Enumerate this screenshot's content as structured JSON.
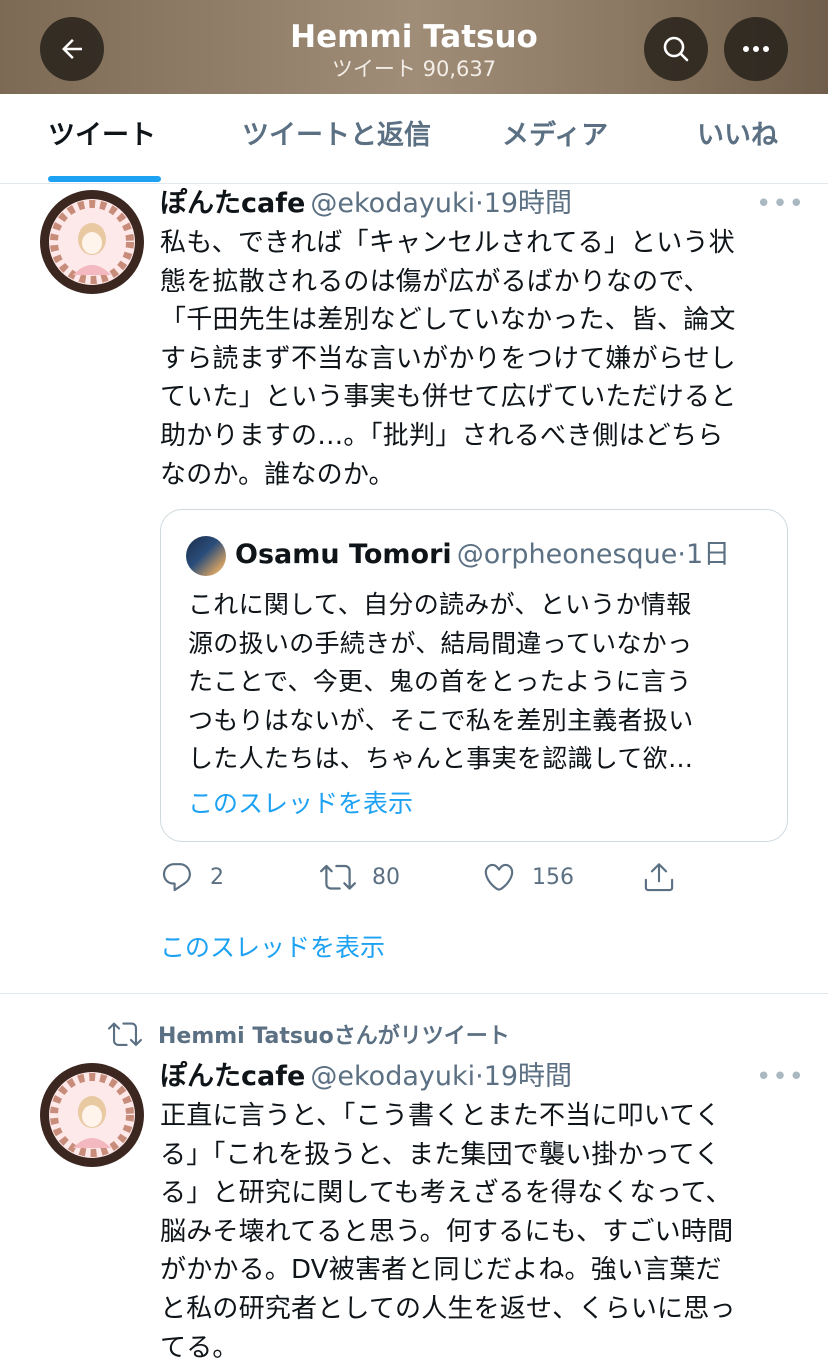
{
  "header": {
    "title": "Hemmi Tatsuo",
    "subtitle": "ツイート 90,637"
  },
  "tabs": [
    {
      "label": "ツイート",
      "active": true
    },
    {
      "label": "ツイートと返信",
      "active": false
    },
    {
      "label": "メディア",
      "active": false
    },
    {
      "label": "いいね",
      "active": false
    }
  ],
  "tweet1": {
    "name": "ぽんたcafe",
    "handle": "@ekodayuki",
    "time": "19時間",
    "more": "•••",
    "lines": [
      "私も、できれば「キャンセルされてる」という状",
      "態を拡散されるのは傷が広がるばかりなので、",
      "「千田先生は差別などしていなかった、皆、論文",
      "すら読まず不当な言いがかりをつけて嫌がらせし",
      "ていた」という事実も併せて広げていただけると",
      "助かりますの…。「批判」されるべき側はどちら",
      "なのか。誰なのか。"
    ],
    "quote": {
      "name": "Osamu Tomori",
      "handle": "@orpheonesque",
      "time": "1日",
      "lines": [
        "これに関して、自分の読みが、というか情報",
        "源の扱いの手続きが、結局間違っていなかっ",
        "たことで、今更、鬼の首をとったように言う",
        "つもりはないが、そこで私を差別主義者扱い",
        "した人たちは、ちゃんと事実を認識して欲…"
      ],
      "thread_link": "このスレッドを表示"
    },
    "actions": {
      "reply_count": "2",
      "retweet_count": "80",
      "like_count": "156"
    },
    "thread_link": "このスレッドを表示"
  },
  "tweet2": {
    "retweeted_by": "Hemmi Tatsuoさんがリツイート",
    "name": "ぽんたcafe",
    "handle": "@ekodayuki",
    "time": "19時間",
    "more": "•••",
    "lines": [
      "正直に言うと、「こう書くとまた不当に叩いてく",
      "る」「これを扱うと、また集団で襲い掛かってく",
      "る」と研究に関しても考えざるを得なくなって、",
      "脳みそ壊れてると思う。何するにも、すごい時間",
      "がかかる。DV被害者と同じだよね。強い言葉だ",
      "と私の研究者としての人生を返せ、くらいに思っ",
      "てる。"
    ]
  },
  "colors": {
    "accent": "#1da1f2",
    "secondary_text": "#5b7083",
    "primary_text": "#0f1419"
  }
}
